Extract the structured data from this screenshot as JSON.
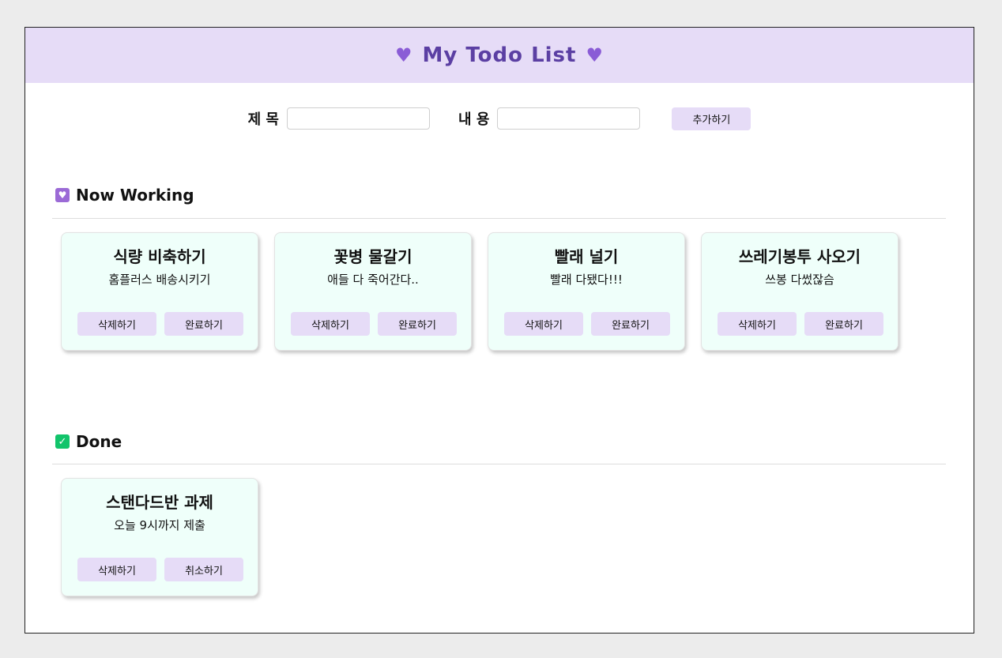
{
  "header": {
    "title": "My Todo List",
    "left_icon": "purple-heart-icon",
    "right_icon": "purple-heart-icon",
    "background": "#e6dcf7",
    "title_color": "#5b3fa3"
  },
  "form": {
    "title_label": "제 목",
    "title_value": "",
    "content_label": "내 용",
    "content_value": "",
    "add_label": "추가하기"
  },
  "working": {
    "heading": "Now Working",
    "icon": "heart-decoration-icon",
    "cards": [
      {
        "title": "식량 비축하기",
        "content": "홈플러스 배송시키기",
        "delete_label": "삭제하기",
        "toggle_label": "완료하기"
      },
      {
        "title": "꽃병 물갈기",
        "content": "애들 다 죽어간다..",
        "delete_label": "삭제하기",
        "toggle_label": "완료하기"
      },
      {
        "title": "빨래 널기",
        "content": "빨래 다됐다!!!",
        "delete_label": "삭제하기",
        "toggle_label": "완료하기"
      },
      {
        "title": "쓰레기봉투 사오기",
        "content": "쓰봉 다썼잖슴",
        "delete_label": "삭제하기",
        "toggle_label": "완료하기"
      }
    ]
  },
  "done": {
    "heading": "Done",
    "icon": "check-mark-icon",
    "cards": [
      {
        "title": "스탠다드반 과제",
        "content": "오늘 9시까지 제출",
        "delete_label": "삭제하기",
        "toggle_label": "취소하기"
      }
    ]
  },
  "colors": {
    "accent": "#e6dcf7",
    "card_background": "#effffa",
    "done_icon": "#12c46b",
    "working_icon": "#9b6ad6"
  }
}
